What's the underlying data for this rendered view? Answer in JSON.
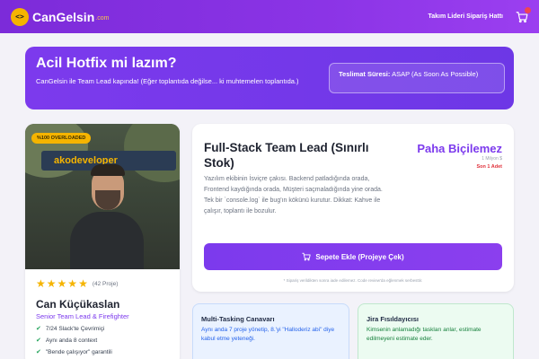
{
  "header": {
    "logo_text": "CanGelsin",
    "logo_suffix": ".com",
    "nav_link": "Takım Lideri Sipariş Hattı",
    "icons": {
      "logo": "code-brackets-icon",
      "cart": "cart-icon"
    }
  },
  "banner": {
    "title": "Acil Hotfix mi lazım?",
    "description": "CanGelsin ile Team Lead kapında! (Eğer toplantıda değilse... ki muhtemelen toplantıda.)",
    "delivery_label": "Teslimat Süresi:",
    "delivery_value": "ASAP (As Soon As Possible)"
  },
  "profile": {
    "badge": "%100 OVERLOADED",
    "rating_stars": 5,
    "reviews": "(42 Proje)",
    "name": "Can Küçükaslan",
    "role": "Senior Team Lead & Firefighter",
    "features": [
      "7/24 Slack'te Çevrimiçi",
      "Aynı anda 8 context",
      "\"Bende çalışıyor\" garantili"
    ]
  },
  "product": {
    "title": "Full-Stack Team Lead (Sınırlı Stok)",
    "price": "Paha Biçilemez",
    "price_sub": "1 Milyon $",
    "stock": "Son 1 Adet",
    "description": "Yazılım ekibinin İsviçre çakısı. Backend patladığında orada, Frontend kaydığında orada, Müşteri saçmaladığında yine orada. Tek bir `console.log` ile bug'ın kökünü kurutur. Dikkat: Kahve ile çalışır, toplantı ile bozulur.",
    "add_button": "Sepete Ekle (Projeye Çek)",
    "footnote": "* Sipariş verildikten sonra iade edilemez. Code review'da eğlenmek serbesttir."
  },
  "cards": [
    {
      "title": "Multi-Tasking Canavarı",
      "text": "Aynı anda 7 proje yönetip, 8.'yi \"Halloderiz abi\" diye kabul etme yeteneği."
    },
    {
      "title": "Jira Fısıldayıcısı",
      "text": "Kimsenin anlamadığı taskları anlar, estimate edilmeyeni estimate eder."
    }
  ],
  "colors": {
    "primary": "#7c3aed",
    "accent": "#f5b400",
    "danger": "#e0313b"
  }
}
